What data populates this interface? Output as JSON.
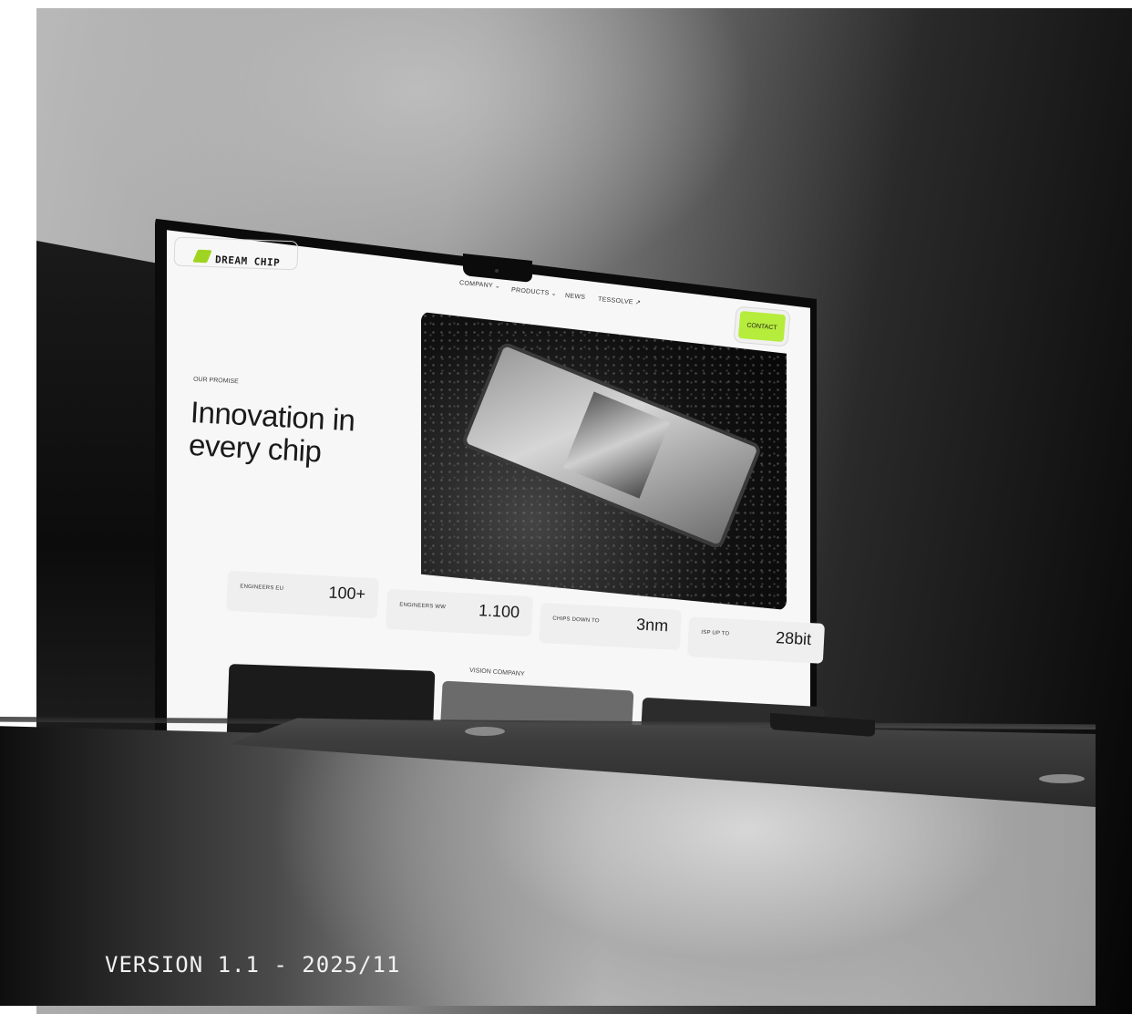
{
  "site": {
    "logo_text": "DREAM CHIP",
    "nav": {
      "company": "COMPANY ⌄",
      "products": "PRODUCTS ⌄",
      "news": "NEWS",
      "tessolve": "TESSOLVE ↗"
    },
    "contact_label": "CONTACT",
    "hero": {
      "eyebrow": "OUR PROMISE",
      "headline_line1": "Innovation in",
      "headline_line2": "every chip"
    },
    "stats": [
      {
        "label": "ENGINEERS EU",
        "value": "100+"
      },
      {
        "label": "ENGINEERS WW",
        "value": "1.100"
      },
      {
        "label": "CHIPS DOWN TO",
        "value": "3nm"
      },
      {
        "label": "ISP UP TO",
        "value": "28bit"
      }
    ],
    "section_label": "VISION COMPANY"
  },
  "caption": "VERSION 1.1 - 2025/11",
  "colors": {
    "accent": "#b6ec3b",
    "screen_bg": "#f7f7f7",
    "laptop_bezel": "#0b0b0b"
  },
  "icons": {
    "logo": "dream-chip-logo-icon"
  }
}
